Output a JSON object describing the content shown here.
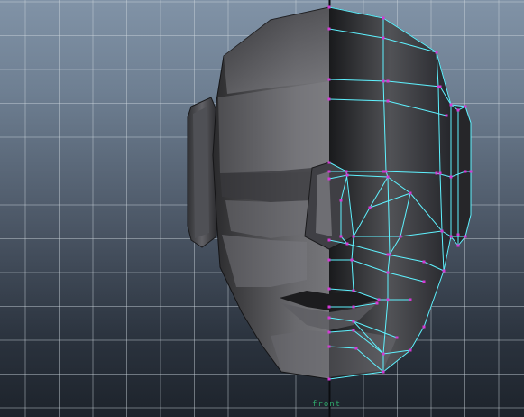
{
  "viewport": {
    "camera_label": "front",
    "background_top": "#8193a7",
    "background_bottom": "#1d232b",
    "grid_color": "#c9d0d8",
    "wire_color": "#5ff2ff",
    "vertex_color": "#d43ad6"
  }
}
